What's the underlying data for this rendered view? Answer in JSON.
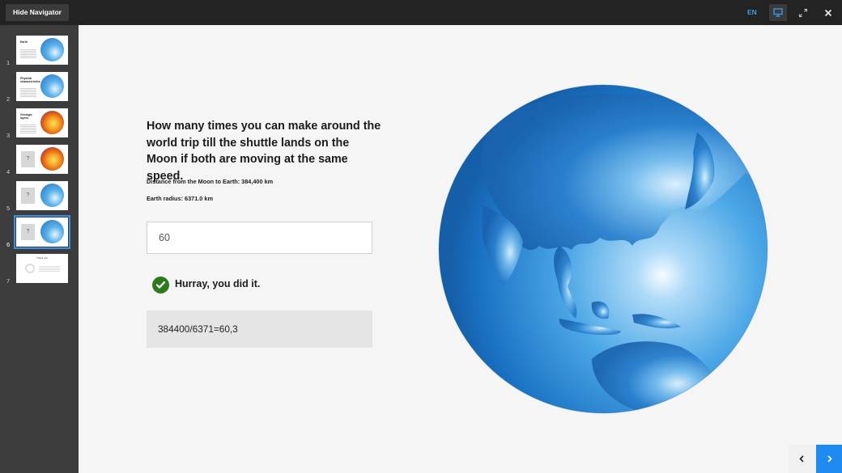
{
  "topbar": {
    "hide_navigator_label": "Hide Navigator",
    "language": "EN",
    "icons": [
      "presentation-icon",
      "fullscreen-icon",
      "close-icon"
    ],
    "accent_color": "#3d9ce6"
  },
  "navigator": {
    "slides": [
      {
        "number": "1",
        "title": "Earth"
      },
      {
        "number": "2",
        "title": "Physical characteristics"
      },
      {
        "number": "3",
        "title": "Geologic layers"
      },
      {
        "number": "4",
        "title": "?"
      },
      {
        "number": "5",
        "title": "?"
      },
      {
        "number": "6",
        "title": "?"
      },
      {
        "number": "7",
        "title": "Thank you"
      }
    ],
    "active_slide": 6
  },
  "slide": {
    "question": "How many times you can make around the world trip till the shuttle lands on the Moon if both are moving at the same speed.",
    "distance_fact": "Distance from the Moon to Earth: 384,400 km",
    "radius_fact": "Earth radius: 6371.0 km",
    "answer_value": "60",
    "feedback": "Hurray, you did it.",
    "solution": "384400/6371=60,3",
    "success_color": "#2f7a1f"
  },
  "nav_buttons": {
    "prev_icon": "chevron-left-icon",
    "next_icon": "chevron-right-icon",
    "next_color": "#1f8bf0"
  }
}
